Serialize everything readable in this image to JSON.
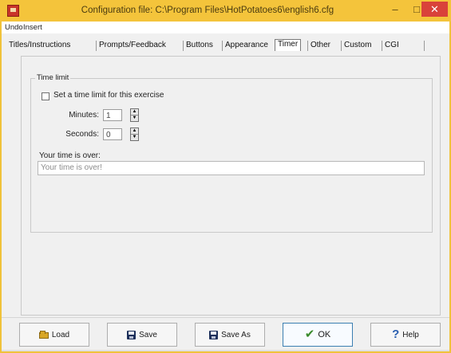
{
  "window": {
    "title": "Configuration file: C:\\Program Files\\HotPotatoes6\\english6.cfg",
    "controls": {
      "minimize": "–",
      "maximize": "□",
      "close": "✕"
    }
  },
  "menu": {
    "items": [
      "Undo",
      "Insert"
    ]
  },
  "tabs": [
    {
      "label": "Titles/Instructions",
      "active": false
    },
    {
      "label": "Prompts/Feedback",
      "active": false
    },
    {
      "label": "Buttons",
      "active": false
    },
    {
      "label": "Appearance",
      "active": false
    },
    {
      "label": "Timer",
      "active": true
    },
    {
      "label": "Other",
      "active": false
    },
    {
      "label": "Custom",
      "active": false
    },
    {
      "label": "CGI",
      "active": false
    }
  ],
  "timer": {
    "group_label": "Time limit",
    "checkbox_label": "Set a time limit for this exercise",
    "checkbox_checked": false,
    "minutes_label": "Minutes:",
    "minutes_value": "1",
    "seconds_label": "Seconds:",
    "seconds_value": "0",
    "message_label": "Your time is over:",
    "message_value": "Your time is over!"
  },
  "buttons": {
    "load": "Load",
    "save": "Save",
    "save_as": "Save As",
    "ok": "OK",
    "help": "Help"
  },
  "icons": {
    "app": "hot-potatoes-app-icon",
    "load": "folder-icon",
    "save": "disk-icon",
    "save_as": "disk-icon",
    "ok": "check-icon",
    "help": "question-icon"
  },
  "colors": {
    "titlebar": "#f4c43b",
    "close_button": "#d9423a",
    "ok_check": "#3a8b2c",
    "help_icon": "#2a5fb0"
  }
}
